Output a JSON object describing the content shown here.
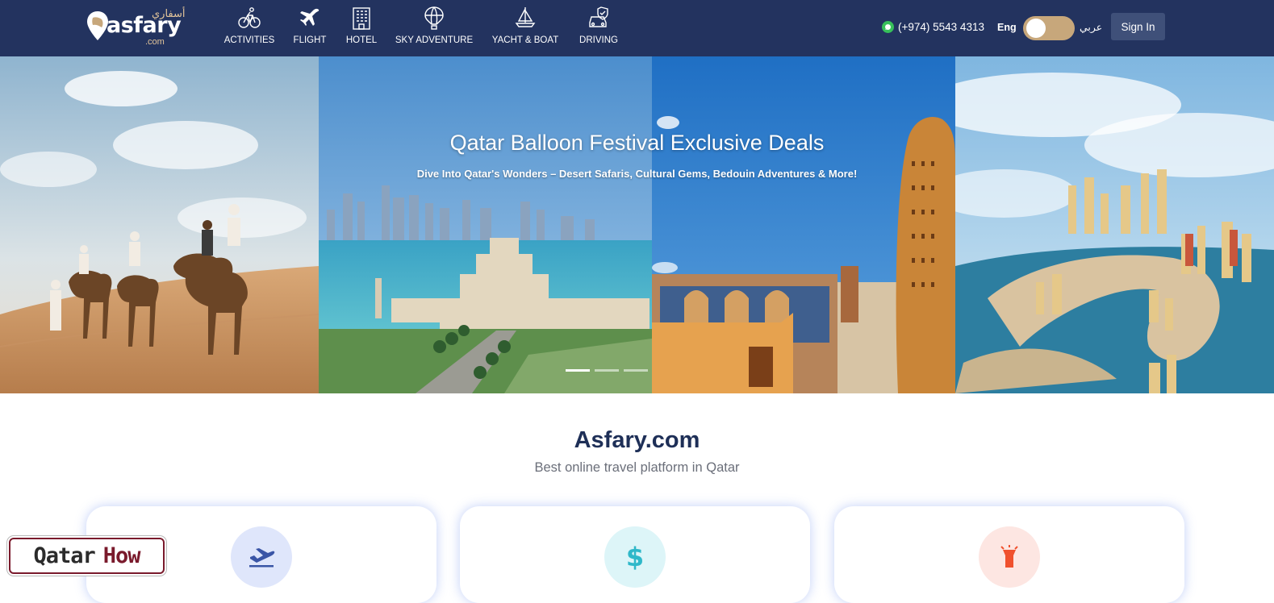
{
  "colors": {
    "navbar": "#23335f",
    "accent_gold": "#c7a77b",
    "signin_bg": "#3f5079",
    "brand_title": "#1e2f57",
    "whatsapp": "#37c05a"
  },
  "header": {
    "logo": {
      "name": "asfary",
      "arabic": "أسفاري",
      "suffix": ".com"
    },
    "nav": [
      {
        "label": "ACTIVITIES",
        "icon": "cyclist-icon"
      },
      {
        "label": "FLIGHT",
        "icon": "airplane-icon"
      },
      {
        "label": "HOTEL",
        "icon": "hotel-building-icon"
      },
      {
        "label": "SKY ADVENTURE",
        "icon": "hot-air-balloon-icon"
      },
      {
        "label": "YACHT & BOAT",
        "icon": "sailboat-icon"
      },
      {
        "label": "DRIVING",
        "icon": "car-shield-icon"
      }
    ],
    "phone": "(+974) 5543 4313",
    "lang_en": "Eng",
    "lang_ar": "عربي",
    "signin_label": "Sign In"
  },
  "hero": {
    "title": "Qatar Balloon Festival Exclusive Deals",
    "subtitle": "Dive Into Qatar's Wonders – Desert Safaris, Cultural Gems, Bedouin Adventures & More!",
    "active_slide": 1,
    "slide_count": 3
  },
  "intro": {
    "title": "Asfary.com",
    "subtitle": "Best online travel platform in Qatar"
  },
  "features": [
    {
      "icon": "airplane-departure-icon"
    },
    {
      "icon": "dollar-icon"
    },
    {
      "icon": "flashlight-icon"
    }
  ],
  "watermark": {
    "part1": "Qatar",
    "part2": "How"
  }
}
